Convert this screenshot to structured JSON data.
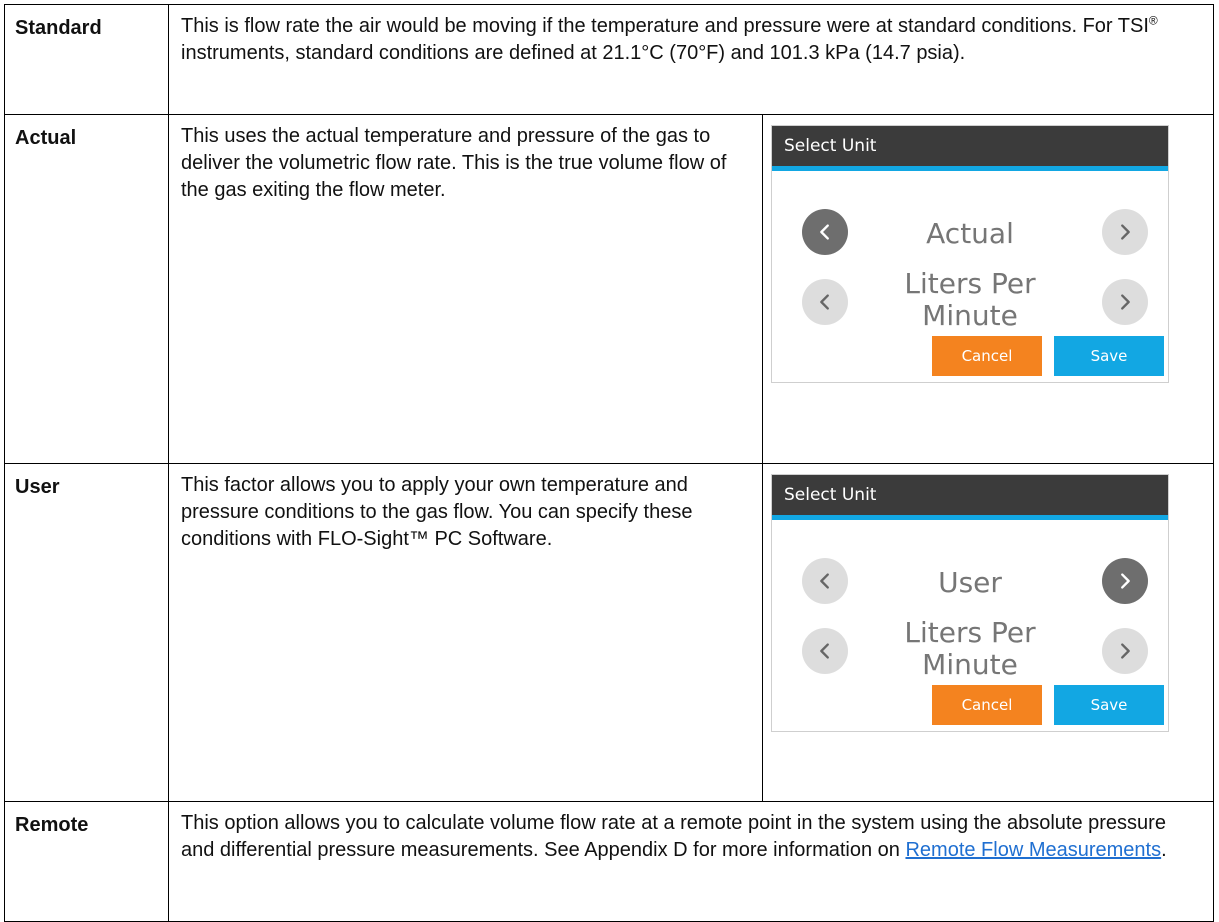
{
  "rows": {
    "standard": {
      "term": "Standard",
      "desc_before_reg": "This is flow rate the air would be moving if the temperature and pressure were at standard conditions. For TSI",
      "reg_mark": "®",
      "desc_after_reg": " instruments, standard conditions are defined at 21.1°C (70°F) and 101.3 kPa (14.7 psia)."
    },
    "actual": {
      "term": "Actual",
      "desc": "This uses the actual temperature and pressure of the gas to deliver the volumetric flow rate. This is the true volume flow of the gas exiting the flow meter.",
      "screen": {
        "title": "Select Unit",
        "option_value": "Actual",
        "unit_value": "Liters Per Minute",
        "cancel_label": "Cancel",
        "save_label": "Save"
      }
    },
    "user": {
      "term": "User",
      "desc": "This factor allows you to apply your own temperature and pressure conditions to the gas flow. You can specify these conditions with FLO-Sight™ PC Software.",
      "screen": {
        "title": "Select Unit",
        "option_value": "User",
        "unit_value": "Liters Per Minute",
        "cancel_label": "Cancel",
        "save_label": "Save"
      }
    },
    "remote": {
      "term": "Remote",
      "desc_before_link": "This option allows you to calculate volume flow rate at a remote point in the system using the absolute pressure and differential pressure measurements. See Appendix D for more information on ",
      "link_text": "Remote Flow Measurements",
      "desc_after_link": "."
    }
  },
  "icons": {
    "prev": "chevron-left-icon",
    "next": "chevron-right-icon"
  },
  "colors": {
    "header_bg": "#3b3b3b",
    "accent_blue": "#12a7e3",
    "cancel_orange": "#f4831f",
    "arrow_light": "#dddddd",
    "arrow_dark": "#6e6e6e",
    "link": "#1f6fd1"
  }
}
